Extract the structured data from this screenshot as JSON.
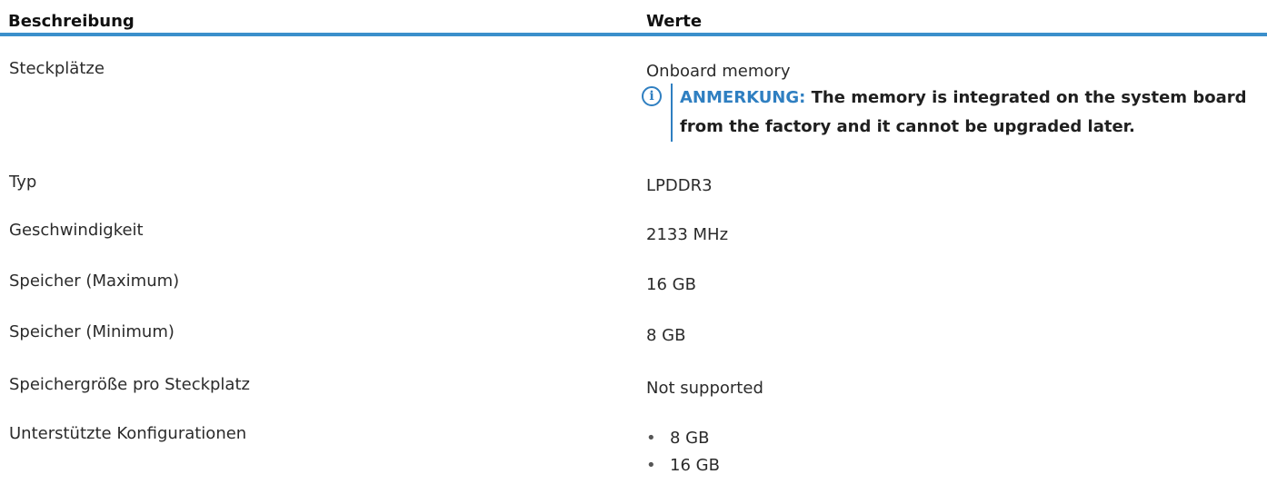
{
  "table": {
    "header": {
      "description": "Beschreibung",
      "values": "Werte"
    },
    "rows": [
      {
        "label": "Steckplätze",
        "value": "Onboard memory",
        "note": {
          "label": "ANMERKUNG:",
          "text": "The memory is integrated on the system board from the factory and it cannot be upgraded later.",
          "icon": "info-icon"
        }
      },
      {
        "label": "Typ",
        "value": "LPDDR3"
      },
      {
        "label": "Geschwindigkeit",
        "value": "2133 MHz"
      },
      {
        "label": "Speicher (Maximum)",
        "value": "16 GB"
      },
      {
        "label": "Speicher (Minimum)",
        "value": "8 GB"
      },
      {
        "label": "Speichergröße pro Steckplatz",
        "value": "Not supported"
      },
      {
        "label": "Unterstützte Konfigurationen",
        "bullet": "•",
        "values": [
          "8 GB",
          "16 GB"
        ]
      }
    ]
  },
  "colors": {
    "accent": "#3b8fcb",
    "note_label": "#2f7fc1"
  }
}
